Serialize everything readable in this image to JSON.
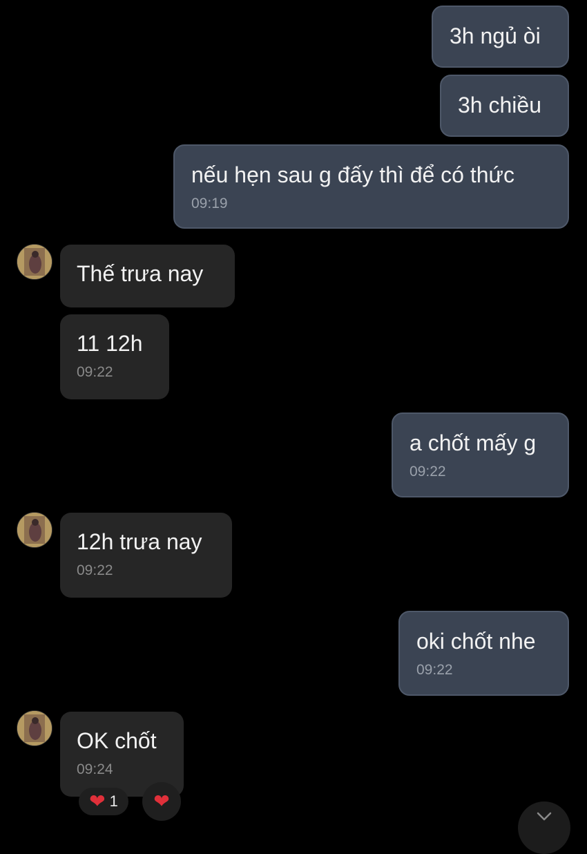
{
  "messages": [
    {
      "id": "m1",
      "direction": "outgoing",
      "text": "3h ngủ òi",
      "time": ""
    },
    {
      "id": "m2",
      "direction": "outgoing",
      "text": "3h chiều",
      "time": ""
    },
    {
      "id": "m3",
      "direction": "outgoing",
      "text": "nếu hẹn sau g đấy thì để có thức",
      "time": "09:19"
    },
    {
      "id": "m4",
      "direction": "incoming",
      "text": "Thế trưa nay",
      "time": ""
    },
    {
      "id": "m5",
      "direction": "incoming",
      "text": "11 12h",
      "time": "09:22"
    },
    {
      "id": "m6",
      "direction": "outgoing",
      "text": "a chốt mấy g",
      "time": "09:22"
    },
    {
      "id": "m7",
      "direction": "incoming",
      "text": "12h trưa nay",
      "time": "09:22"
    },
    {
      "id": "m8",
      "direction": "outgoing",
      "text": "oki chốt nhe",
      "time": "09:22"
    },
    {
      "id": "m9",
      "direction": "incoming",
      "text": "OK chốt",
      "time": "09:24"
    }
  ],
  "reactions": {
    "heart_reaction": {
      "icon": "heart-icon",
      "count": "1"
    },
    "add_heart": {
      "icon": "heart-icon"
    }
  },
  "icons": {
    "heart": "❤",
    "scroll_down": "chevron-down-icon"
  },
  "colors": {
    "outgoing_bubble": "#3b4453",
    "incoming_bubble": "#262626",
    "heart": "#e0303a"
  }
}
